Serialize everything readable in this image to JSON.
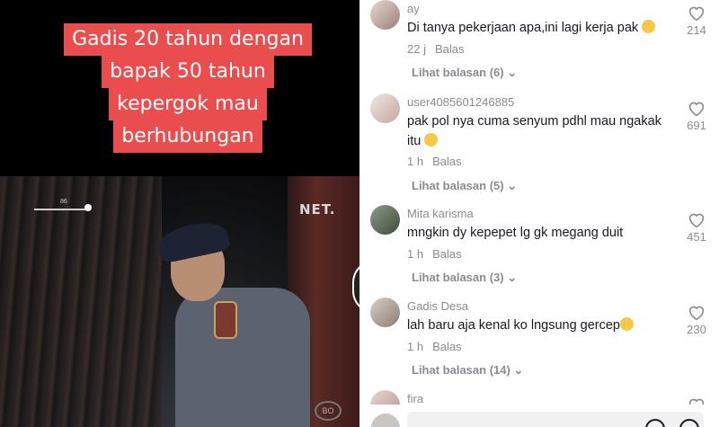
{
  "video": {
    "caption_lines": [
      "Gadis 20 tahun dengan",
      "bapak 50 tahun",
      "kepergok mau",
      "berhubungan"
    ],
    "channel_logo": "NET.",
    "scrub_number": "86"
  },
  "comments": [
    {
      "username": "ay",
      "text": "Di tanya pekerjaan apa,ini lagi kerja pak",
      "emoji": "pleading-face",
      "time": "22 j",
      "reply_label": "Balas",
      "view_replies": "Lihat balasan (6)",
      "likes": "214"
    },
    {
      "username": "user4085601246885",
      "text": "pak pol nya cuma senyum pdhl mau ngakak itu",
      "emoji": "tears-of-joy",
      "time": "1 h",
      "reply_label": "Balas",
      "view_replies": "Lihat balasan (5)",
      "likes": "691"
    },
    {
      "username": "Mita karisma",
      "text": "mngkin dy kepepet lg gk megang duit",
      "emoji": "",
      "time": "1 h",
      "reply_label": "Balas",
      "view_replies": "Lihat balasan (3)",
      "likes": "451"
    },
    {
      "username": "Gadis Desa",
      "text": "lah baru aja kenal ko lngsung gercep",
      "emoji": "flushed-face",
      "time": "1 h",
      "reply_label": "Balas",
      "view_replies": "Lihat balasan (14)",
      "likes": "230"
    },
    {
      "username": "fira",
      "text": "",
      "emoji": "",
      "time": "",
      "reply_label": "",
      "view_replies": "",
      "likes": ""
    }
  ],
  "colors": {
    "caption_bg": "#ea4d4d",
    "text_primary": "#161823",
    "text_secondary": "#8a8b91"
  }
}
